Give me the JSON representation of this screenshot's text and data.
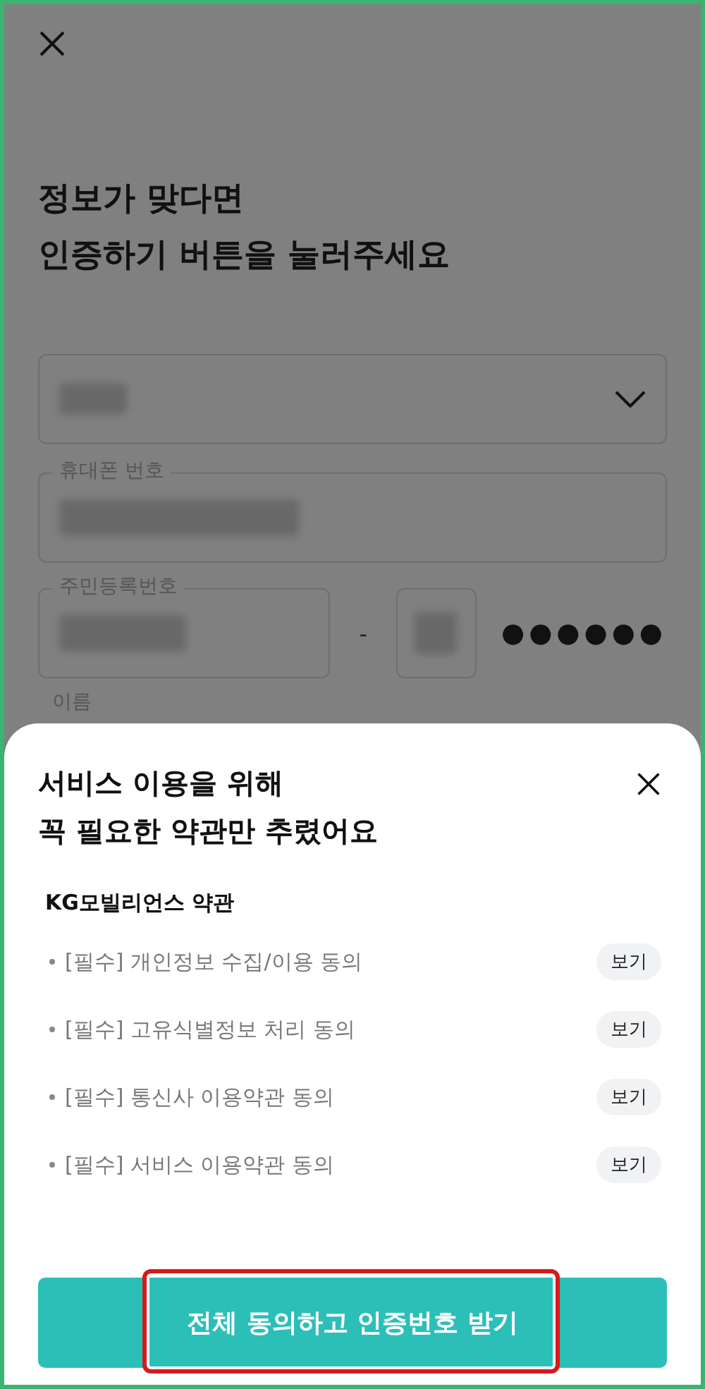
{
  "background": {
    "heading": [
      "정보가 맞다면",
      "인증하기 버튼을 눌러주세요"
    ],
    "carrier_select": {
      "expanded": false
    },
    "phone_field": {
      "label": "휴대폰 번호"
    },
    "id_field": {
      "label": "주민등록번호",
      "separator": "-",
      "masked": "●●●●●●"
    },
    "name_field": {
      "label": "이름"
    }
  },
  "sheet": {
    "title": [
      "서비스 이용을 위해",
      "꼭 필요한 약관만 추렸어요"
    ],
    "section": "KG모빌리언스 약관",
    "terms": [
      {
        "text": "[필수] 개인정보 수집/이용 동의",
        "view": "보기"
      },
      {
        "text": "[필수] 고유식별정보 처리 동의",
        "view": "보기"
      },
      {
        "text": "[필수] 통신사 이용약관 동의",
        "view": "보기"
      },
      {
        "text": "[필수] 서비스 이용약관 동의",
        "view": "보기"
      }
    ],
    "confirm": "전체 동의하고 인증번호 받기"
  }
}
